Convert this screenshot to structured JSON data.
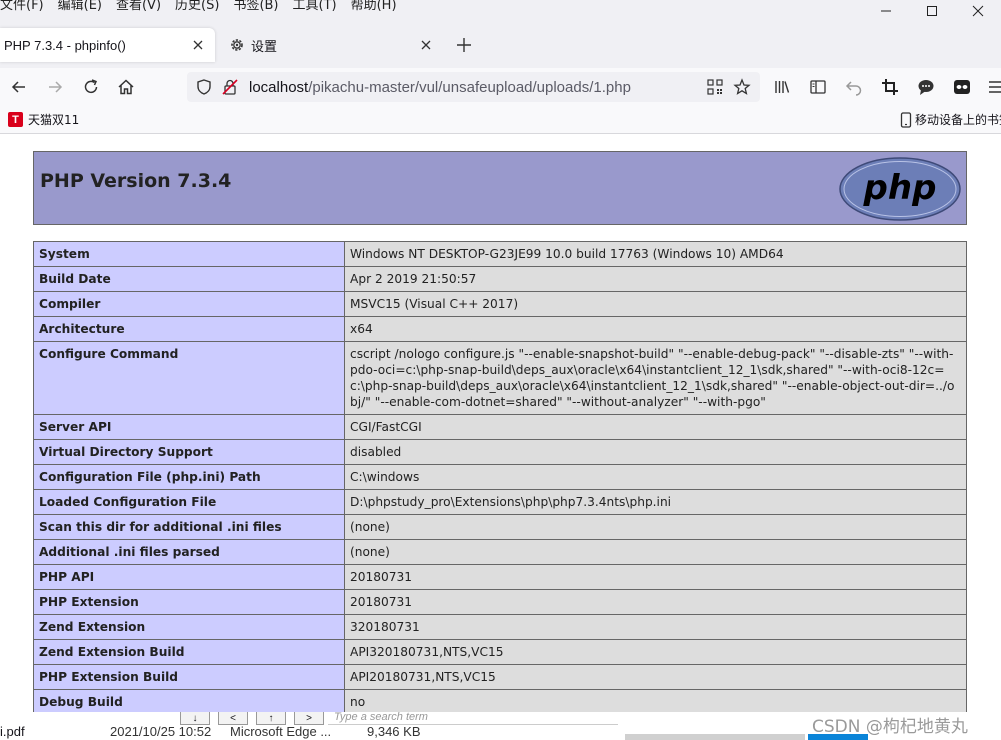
{
  "menubar": {
    "items": [
      "文件(F)",
      "编辑(E)",
      "查看(V)",
      "历史(S)",
      "书签(B)",
      "工具(T)",
      "帮助(H)"
    ]
  },
  "tabs": [
    {
      "title": "PHP 7.3.4 - phpinfo()",
      "active": true
    },
    {
      "title": "设置",
      "active": false,
      "icon": "gear-icon"
    }
  ],
  "urlbar": {
    "host": "localhost",
    "path": "/pikachu-master/vul/unsafeupload/uploads/1.php"
  },
  "bookmarks": {
    "left_label": "天猫双11",
    "left_logo": "T",
    "right_label": "移动设备上的书签"
  },
  "php": {
    "title": "PHP Version 7.3.4",
    "logo_text": "php",
    "rows": [
      {
        "key": "System",
        "value": "Windows NT DESKTOP-G23JE99 10.0 build 17763 (Windows 10) AMD64"
      },
      {
        "key": "Build Date",
        "value": "Apr 2 2019 21:50:57"
      },
      {
        "key": "Compiler",
        "value": "MSVC15 (Visual C++ 2017)"
      },
      {
        "key": "Architecture",
        "value": "x64"
      },
      {
        "key": "Configure Command",
        "value": "cscript /nologo configure.js \"--enable-snapshot-build\" \"--enable-debug-pack\" \"--disable-zts\" \"--with-pdo-oci=c:\\php-snap-build\\deps_aux\\oracle\\x64\\instantclient_12_1\\sdk,shared\" \"--with-oci8-12c=c:\\php-snap-build\\deps_aux\\oracle\\x64\\instantclient_12_1\\sdk,shared\" \"--enable-object-out-dir=../obj/\" \"--enable-com-dotnet=shared\" \"--without-analyzer\" \"--with-pgo\""
      },
      {
        "key": "Server API",
        "value": "CGI/FastCGI"
      },
      {
        "key": "Virtual Directory Support",
        "value": "disabled"
      },
      {
        "key": "Configuration File (php.ini) Path",
        "value": "C:\\windows"
      },
      {
        "key": "Loaded Configuration File",
        "value": "D:\\phpstudy_pro\\Extensions\\php\\php7.3.4nts\\php.ini"
      },
      {
        "key": "Scan this dir for additional .ini files",
        "value": "(none)"
      },
      {
        "key": "Additional .ini files parsed",
        "value": "(none)"
      },
      {
        "key": "PHP API",
        "value": "20180731"
      },
      {
        "key": "PHP Extension",
        "value": "20180731"
      },
      {
        "key": "Zend Extension",
        "value": "320180731"
      },
      {
        "key": "Zend Extension Build",
        "value": "API320180731,NTS,VC15"
      },
      {
        "key": "PHP Extension Build",
        "value": "API20180731,NTS,VC15"
      },
      {
        "key": "Debug Build",
        "value": "no"
      }
    ]
  },
  "downloads": {
    "file": "i.pdf",
    "date": "2021/10/25 10:52",
    "app": "Microsoft Edge ...",
    "size": "9,346 KB",
    "search_placeholder": "Type a search term"
  },
  "watermark": "CSDN @枸杞地黄丸"
}
